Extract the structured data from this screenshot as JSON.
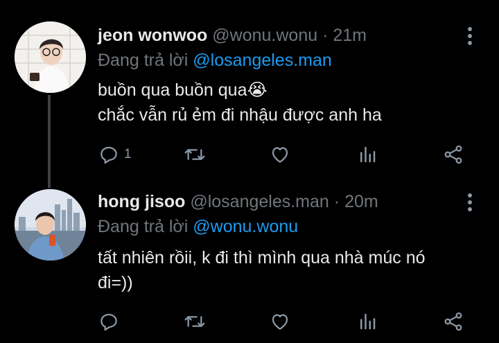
{
  "tweets": [
    {
      "name": "jeon wonwoo",
      "handle": "@wonu.wonu",
      "separator": "·",
      "time": "21m",
      "reply_prefix": "Đang trả lời",
      "reply_to": "@losangeles.man",
      "lines": [
        "buồn qua buồn qua😭",
        "chắc vẫn rủ ẻm đi nhậu được anh ha"
      ],
      "reply_count": "1"
    },
    {
      "name": "hong jisoo",
      "handle": "@losangeles.man",
      "separator": "·",
      "time": "20m",
      "reply_prefix": "Đang trả lời",
      "reply_to": "@wonu.wonu",
      "lines": [
        "tất nhiên rồii, k đi thì mình qua nhà múc nó",
        "đi=))"
      ],
      "reply_count": ""
    }
  ],
  "colors": {
    "background": "#000000",
    "text": "#e7e9ea",
    "muted": "#71767b",
    "accent": "#1d9bf0",
    "icon": "#8b98a5"
  }
}
